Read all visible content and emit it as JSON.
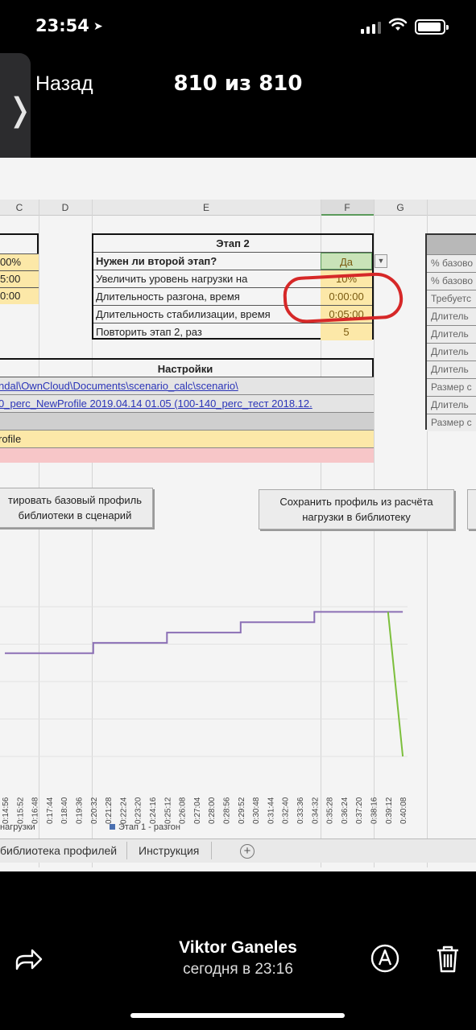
{
  "status": {
    "time": "23:54",
    "location_arrow": "➤"
  },
  "nav": {
    "back": "Назад",
    "counter": "810 из 810",
    "side_arrow": "❭"
  },
  "sheet": {
    "columns": [
      "C",
      "D",
      "E",
      "F",
      "G"
    ],
    "left_values": [
      "00%",
      "5:00",
      "0:00"
    ],
    "stage2": {
      "title": "Этап 2",
      "rows": [
        {
          "label": "Нужен ли второй этап?",
          "value": "Да"
        },
        {
          "label": "Увеличить уровень нагрузки на",
          "value": "10%"
        },
        {
          "label": "Длительность разгона, время",
          "value": "0:00:00"
        },
        {
          "label": "Длительность стабилизации, время",
          "value": "0:05:00"
        },
        {
          "label": "Повторить этап 2, раз",
          "value": "5"
        }
      ]
    },
    "right_rows": [
      "% базово",
      "% базово",
      "Требуетс",
      "Длитель",
      "Длитель",
      "Длитель",
      "Длитель",
      "Размер с",
      "Длитель",
      "Размер с"
    ],
    "settings": {
      "title": "Настройки",
      "path": "ndal\\OwnCloud\\Documents\\scenario_calc\\scenario\\",
      "profile_file": "0_perc_NewProfile    2019.04.14  01.05    (100-140_perc_тест     2018.12.",
      "profile_name": "rofile"
    },
    "buttons": {
      "import": "тировать базовый профиль\nбиблиотеки в сценарий",
      "save": "Сохранить профиль из расчёта\nнагрузки в библиотеку"
    },
    "legend": {
      "series_a": "нагрузки",
      "series_b": "Этап 1 - разгон"
    },
    "tabs": [
      "библиотека профилей",
      "Инструкция"
    ],
    "add_tab": "+"
  },
  "chart_data": {
    "type": "line",
    "x": [
      "0:14:56",
      "0:15:52",
      "0:16:48",
      "0:17:44",
      "0:18:40",
      "0:19:36",
      "0:20:32",
      "0:21:28",
      "0:22:24",
      "0:23:20",
      "0:24:16",
      "0:25:12",
      "0:26:08",
      "0:27:04",
      "0:28:00",
      "0:28:56",
      "0:29:52",
      "0:30:48",
      "0:31:44",
      "0:32:40",
      "0:33:36",
      "0:34:32",
      "0:35:28",
      "0:36:24",
      "0:37:20",
      "0:38:16",
      "0:39:12",
      "0:40:08"
    ],
    "series": [
      {
        "color": "#8b6fb5",
        "values": [
          100,
          100,
          100,
          100,
          100,
          100,
          110,
          110,
          110,
          110,
          110,
          120,
          120,
          120,
          120,
          120,
          130,
          130,
          130,
          130,
          130,
          140,
          140,
          140,
          140,
          140,
          140,
          140
        ]
      },
      {
        "color": "#7cbf3c",
        "values": [
          null,
          null,
          null,
          null,
          null,
          null,
          null,
          null,
          null,
          null,
          null,
          null,
          null,
          null,
          null,
          null,
          null,
          null,
          null,
          null,
          null,
          null,
          null,
          null,
          null,
          null,
          140,
          0
        ]
      }
    ]
  },
  "bottom": {
    "author": "Viktor Ganeles",
    "date": "сегодня в 23:16"
  }
}
